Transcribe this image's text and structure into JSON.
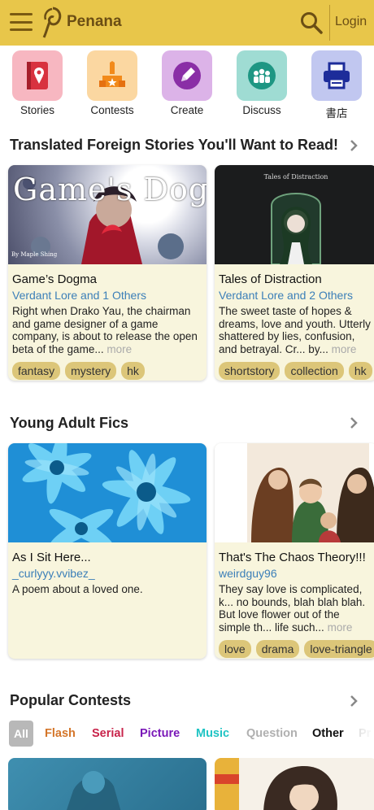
{
  "header": {
    "app_name": "Penana",
    "login_label": "Login",
    "brand_color": "#e8c64a"
  },
  "categories": [
    {
      "label": "Stories",
      "icon": "book-map-icon",
      "color": "#f7b7c1"
    },
    {
      "label": "Contests",
      "icon": "trophy-podium-icon",
      "color": "#fbd7a1"
    },
    {
      "label": "Create",
      "icon": "pencil-icon",
      "color": "#dcb3e8"
    },
    {
      "label": "Discuss",
      "icon": "group-icon",
      "color": "#9fdcd3"
    },
    {
      "label": "書店",
      "icon": "shop-icon",
      "color": "#c1c7f0"
    }
  ],
  "sections": {
    "translated": {
      "title": "Translated Foreign Stories You'll Want to Read!",
      "cards": [
        {
          "title": "Game’s Dogma",
          "cover_text": "Game's Dogma",
          "cover_byline": "By Maple Shing",
          "author": "Verdant Lore and 1 Others",
          "description": "Right when Drako Yau, the chairman and game designer of a game company, is about to release the open beta of the game...",
          "more": "more",
          "tags": [
            "fantasy",
            "mystery",
            "hk"
          ]
        },
        {
          "title": "Tales of Distraction",
          "cover_text": "Tales of Distraction",
          "author": "Verdant Lore and 2 Others",
          "description": "The sweet taste of hopes & dreams, love and youth. Utterly shattered by lies, confusion, and betrayal. Cr... by...",
          "more": "more",
          "tags": [
            "shortstory",
            "collection",
            "hk"
          ]
        }
      ]
    },
    "young_adult": {
      "title": "Young Adult Fics",
      "cards": [
        {
          "title": "As I Sit Here...",
          "author": "_curlyyy.vvibez_",
          "description": "A poem about a loved one.",
          "more": "",
          "tags": []
        },
        {
          "title": "That's The Chaos Theory!!!",
          "author": "weirdguy96",
          "description": "They say love is complicated, k... no bounds, blah blah blah. But love flower out of the simple th... life such...",
          "more": "more",
          "tags": [
            "love",
            "drama",
            "love-triangle"
          ]
        }
      ]
    },
    "contests": {
      "title": "Popular Contests",
      "filters": [
        {
          "label": "All",
          "color": "#ffffff"
        },
        {
          "label": "Flash",
          "color": "#d4762a"
        },
        {
          "label": "Serial",
          "color": "#c8234a"
        },
        {
          "label": "Picture",
          "color": "#7a18b8"
        },
        {
          "label": "Music",
          "color": "#20c4c4"
        },
        {
          "label": "Question",
          "color": "#b0b0b0"
        },
        {
          "label": "Other",
          "color": "#111111"
        },
        {
          "label": "Pr",
          "color": "#cccccc"
        }
      ]
    }
  }
}
